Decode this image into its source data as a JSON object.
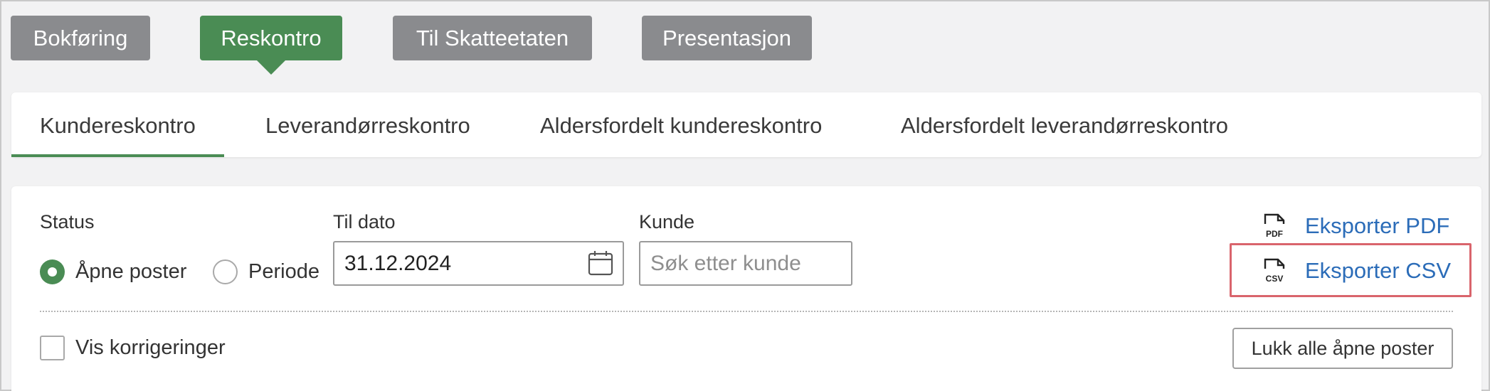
{
  "topnav": {
    "items": [
      {
        "label": "Bokføring",
        "active": false
      },
      {
        "label": "Reskontro",
        "active": true
      },
      {
        "label": "Til Skatteetaten",
        "active": false
      },
      {
        "label": "Presentasjon",
        "active": false
      }
    ]
  },
  "subtabs": {
    "items": [
      {
        "label": "Kundereskontro",
        "active": true
      },
      {
        "label": "Leverandørreskontro",
        "active": false
      },
      {
        "label": "Aldersfordelt kundereskontro",
        "active": false
      },
      {
        "label": "Aldersfordelt leverandørreskontro",
        "active": false
      }
    ]
  },
  "filters": {
    "status_label": "Status",
    "radio_open": "Åpne poster",
    "radio_period": "Periode",
    "selected": "Åpne poster",
    "date_label": "Til dato",
    "date_value": "31.12.2024",
    "customer_label": "Kunde",
    "customer_placeholder": "Søk etter kunde",
    "show_corrections": "Vis korrigeringer"
  },
  "exports": {
    "pdf_label": "Eksporter PDF",
    "pdf_icon_text": "PDF",
    "csv_label": "Eksporter CSV",
    "csv_icon_text": "CSV"
  },
  "actions": {
    "close_all": "Lukk alle åpne poster"
  },
  "colors": {
    "accent": "#4a8c54",
    "inactive_tab": "#8a8b8e",
    "link": "#2b6cb8",
    "highlight": "#d9646c"
  }
}
